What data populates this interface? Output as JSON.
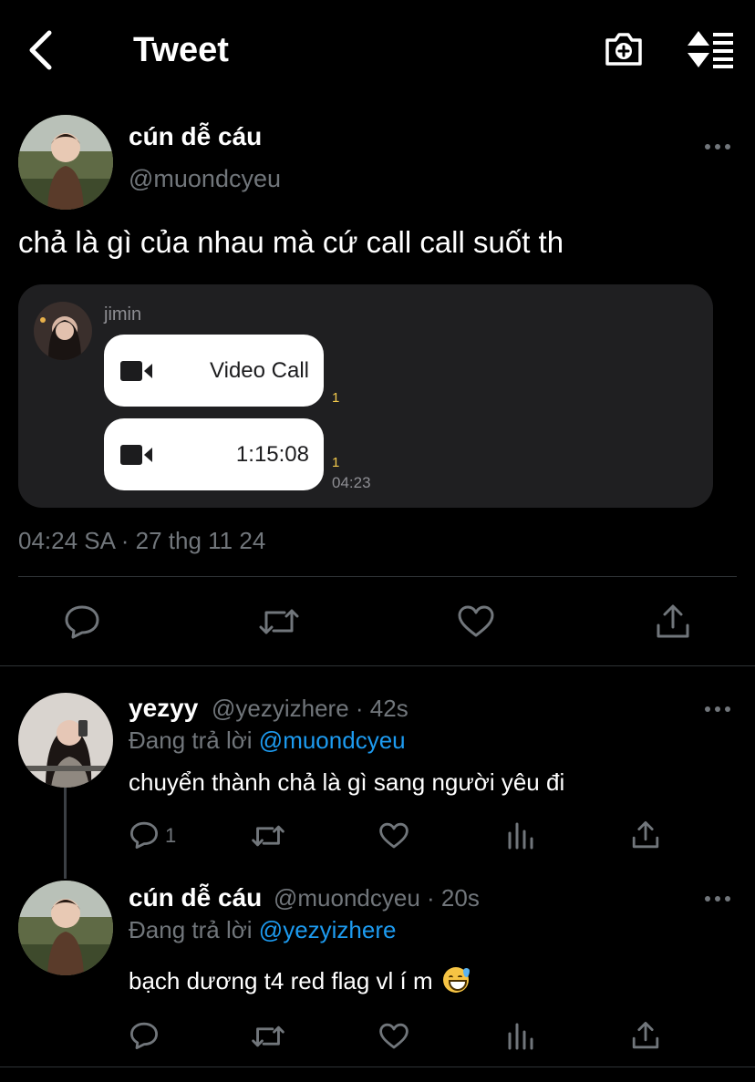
{
  "header": {
    "title": "Tweet",
    "back_icon": "chevron-left-icon",
    "camera_icon": "camera-plus-icon",
    "sort_icon": "sort-list-icon"
  },
  "main_tweet": {
    "author_name": "cún dễ cáu",
    "author_handle": "@muondcyeu",
    "text": "chả là gì của nhau mà cứ call call suốt th",
    "image": {
      "sender_name": "jimin",
      "messages": [
        {
          "label": "Video Call",
          "read_count": "1"
        },
        {
          "label": "1:15:08",
          "read_count": "1",
          "time": "04:23"
        }
      ]
    },
    "timestamp": "04:24 SA · 27 thg 11 24"
  },
  "replies": [
    {
      "author_name": "yezyy",
      "meta": "@yezyizhere · 42s",
      "replying_prefix": "Đang trả lời",
      "replying_to": "@muondcyeu",
      "text": "chuyển thành chả là gì sang người yêu đi",
      "reply_count": "1"
    },
    {
      "author_name": "cún dễ cáu",
      "meta": "@muondcyeu · 20s",
      "replying_prefix": "Đang trả lời",
      "replying_to": "@yezyizhere",
      "text": "bạch dương t4 red flag vl í m"
    }
  ],
  "colors": {
    "background": "#000000",
    "secondary_text": "#71767b",
    "link": "#1d9bf0",
    "divider": "#2f3336"
  }
}
